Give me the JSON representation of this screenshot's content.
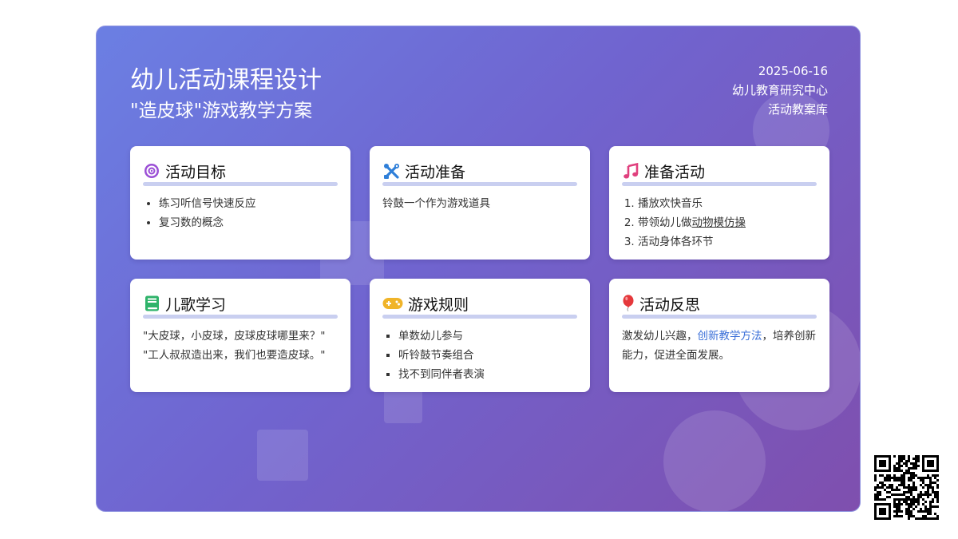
{
  "header": {
    "title": "幼儿活动课程设计",
    "subtitle": "\"造皮球\"游戏教学方案",
    "date": "2025-06-16",
    "org": "幼儿教育研究中心",
    "library": "活动教案库"
  },
  "cards": {
    "goals": {
      "title": "活动目标",
      "icon": "target-icon",
      "items": [
        "练习听信号快速反应",
        "复习数的概念"
      ]
    },
    "prep": {
      "title": "活动准备",
      "icon": "tools-icon",
      "text": "铃鼓一个作为游戏道具"
    },
    "warmup": {
      "title": "准备活动",
      "icon": "music-note-icon",
      "items": [
        "播放欢快音乐",
        "带领幼儿做",
        "动物模仿操",
        "活动身体各环节"
      ]
    },
    "song": {
      "title": "儿歌学习",
      "icon": "book-icon",
      "lines": [
        "\"大皮球，小皮球，皮球皮球哪里来？\"",
        "\"工人叔叔造出来，我们也要造皮球。\""
      ]
    },
    "rules": {
      "title": "游戏规则",
      "icon": "gamepad-icon",
      "items": [
        "单数幼儿参与",
        "听铃鼓节奏组合",
        "找不到同伴者表演"
      ]
    },
    "reflect": {
      "title": "活动反思",
      "icon": "balloon-icon",
      "text_before": "激发幼儿兴趣，",
      "text_link": "创新教学方法",
      "text_after": "，培养创新能力，促进全面发展。"
    }
  },
  "colors": {
    "gradient_start": "#6b7fe3",
    "gradient_end": "#7f4fae",
    "rule": "#c9cff0",
    "link": "#3a6fd8"
  }
}
